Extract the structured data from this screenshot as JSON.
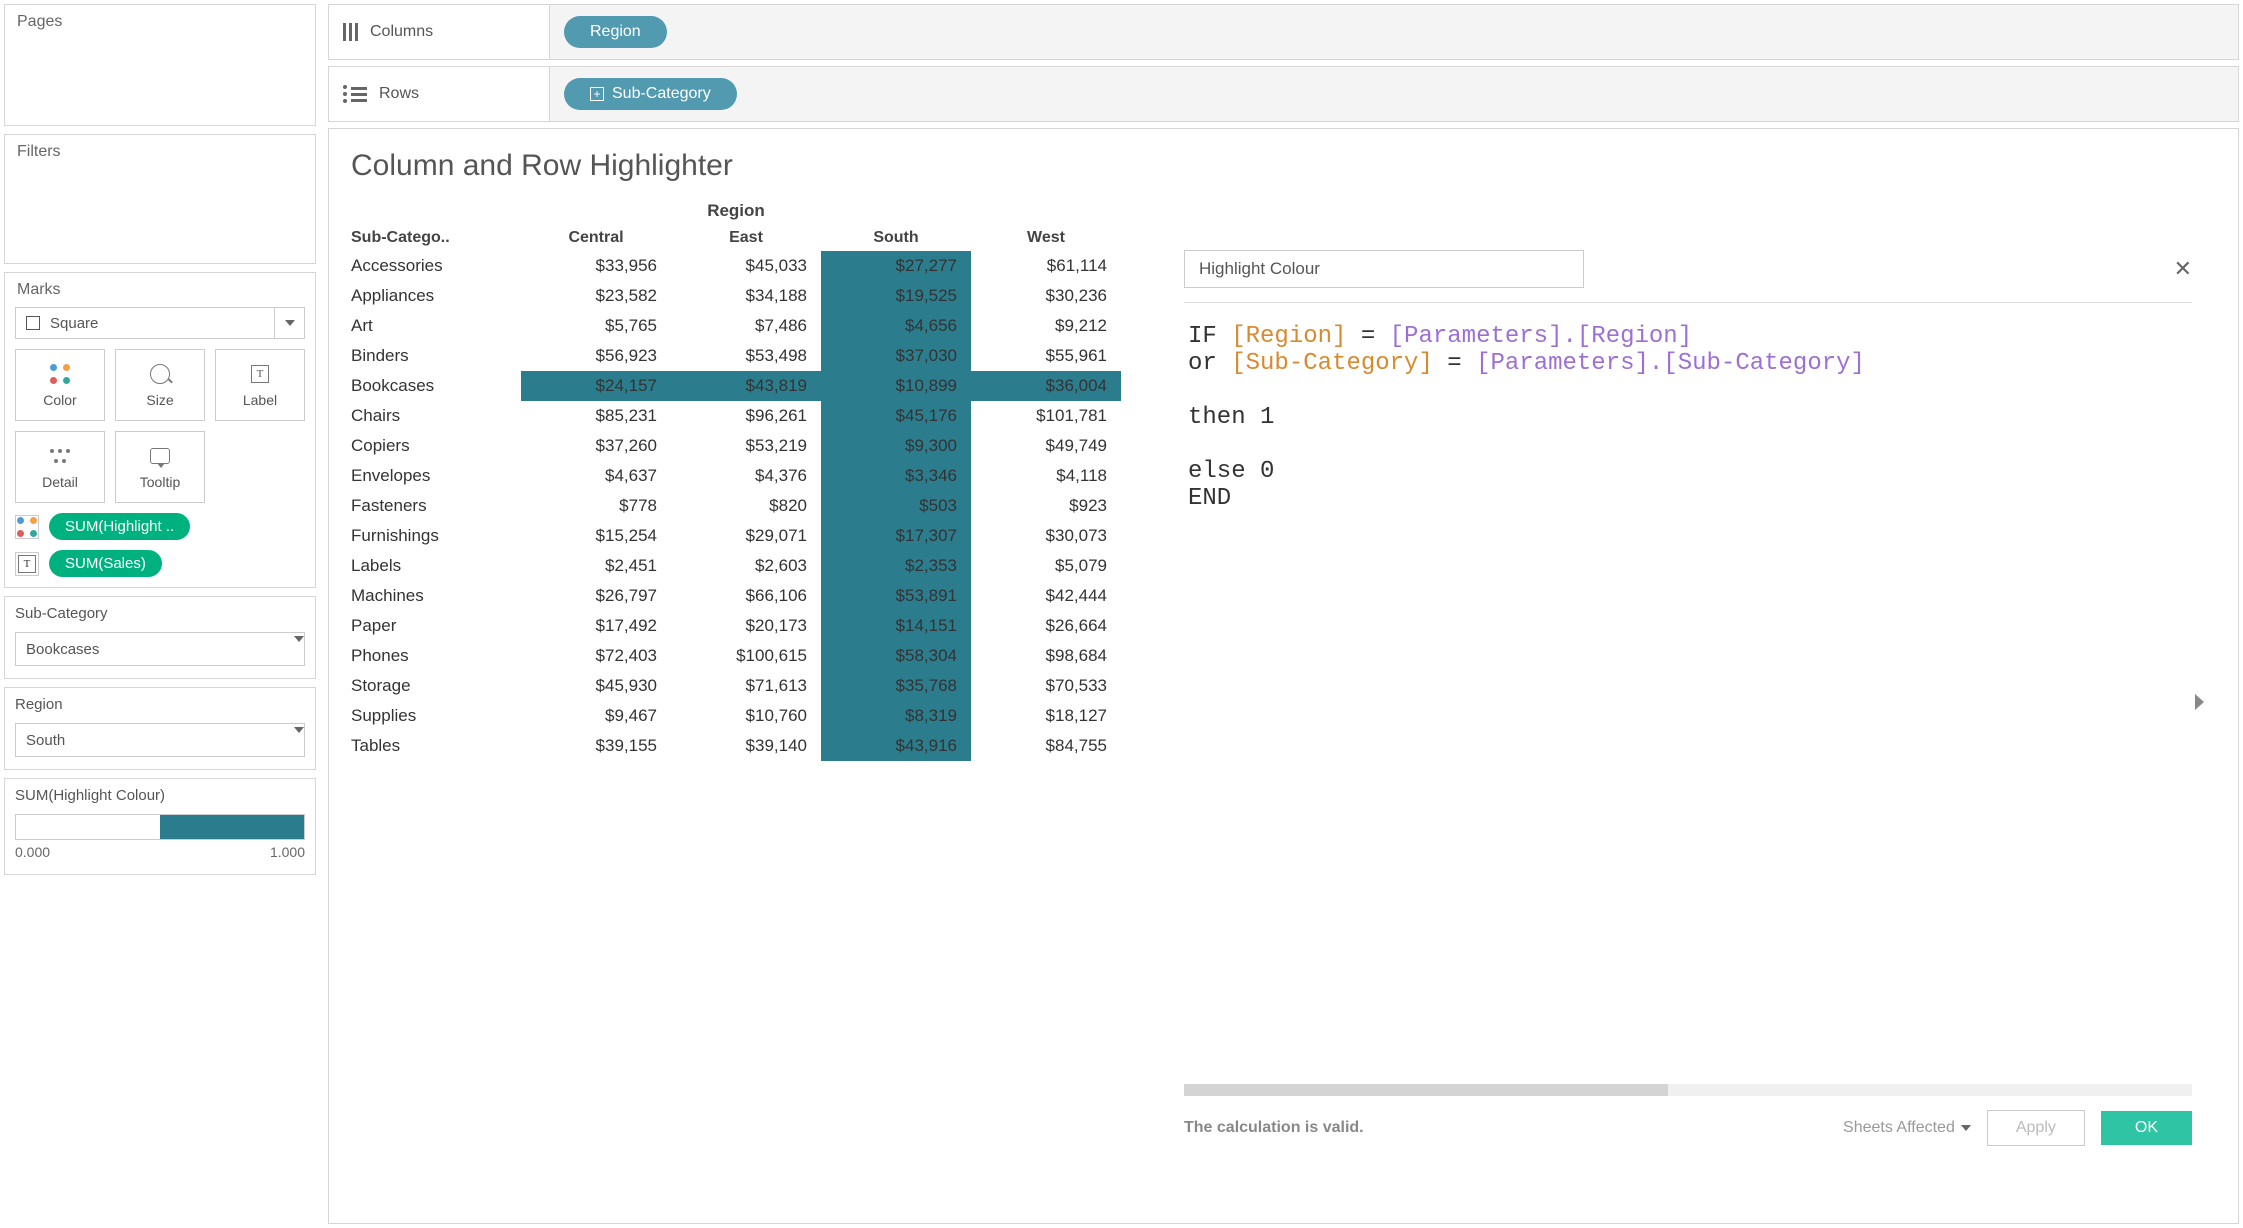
{
  "shelves": {
    "columns_label": "Columns",
    "rows_label": "Rows",
    "columns_pill": "Region",
    "rows_pill": "Sub-Category"
  },
  "left": {
    "pages_title": "Pages",
    "filters_title": "Filters",
    "marks_title": "Marks",
    "mark_type": "Square",
    "mark_buttons": {
      "color": "Color",
      "size": "Size",
      "label": "Label",
      "detail": "Detail",
      "tooltip": "Tooltip"
    },
    "mark_pills": {
      "pill1": "SUM(Highlight ..",
      "pill2": "SUM(Sales)"
    },
    "param_subcat": {
      "title": "Sub-Category",
      "value": "Bookcases"
    },
    "param_region": {
      "title": "Region",
      "value": "South"
    },
    "legend": {
      "title": "SUM(Highlight Colour)",
      "min": "0.000",
      "max": "1.000"
    }
  },
  "viz": {
    "title": "Column and Row Highlighter",
    "col_header": "Region",
    "row_header": "Sub-Catego..",
    "regions": [
      "Central",
      "East",
      "South",
      "West"
    ],
    "rows": [
      {
        "name": "Accessories",
        "vals": [
          "$33,956",
          "$45,033",
          "$27,277",
          "$61,114"
        ]
      },
      {
        "name": "Appliances",
        "vals": [
          "$23,582",
          "$34,188",
          "$19,525",
          "$30,236"
        ]
      },
      {
        "name": "Art",
        "vals": [
          "$5,765",
          "$7,486",
          "$4,656",
          "$9,212"
        ]
      },
      {
        "name": "Binders",
        "vals": [
          "$56,923",
          "$53,498",
          "$37,030",
          "$55,961"
        ]
      },
      {
        "name": "Bookcases",
        "vals": [
          "$24,157",
          "$43,819",
          "$10,899",
          "$36,004"
        ]
      },
      {
        "name": "Chairs",
        "vals": [
          "$85,231",
          "$96,261",
          "$45,176",
          "$101,781"
        ]
      },
      {
        "name": "Copiers",
        "vals": [
          "$37,260",
          "$53,219",
          "$9,300",
          "$49,749"
        ]
      },
      {
        "name": "Envelopes",
        "vals": [
          "$4,637",
          "$4,376",
          "$3,346",
          "$4,118"
        ]
      },
      {
        "name": "Fasteners",
        "vals": [
          "$778",
          "$820",
          "$503",
          "$923"
        ]
      },
      {
        "name": "Furnishings",
        "vals": [
          "$15,254",
          "$29,071",
          "$17,307",
          "$30,073"
        ]
      },
      {
        "name": "Labels",
        "vals": [
          "$2,451",
          "$2,603",
          "$2,353",
          "$5,079"
        ]
      },
      {
        "name": "Machines",
        "vals": [
          "$26,797",
          "$66,106",
          "$53,891",
          "$42,444"
        ]
      },
      {
        "name": "Paper",
        "vals": [
          "$17,492",
          "$20,173",
          "$14,151",
          "$26,664"
        ]
      },
      {
        "name": "Phones",
        "vals": [
          "$72,403",
          "$100,615",
          "$58,304",
          "$98,684"
        ]
      },
      {
        "name": "Storage",
        "vals": [
          "$45,930",
          "$71,613",
          "$35,768",
          "$70,533"
        ]
      },
      {
        "name": "Supplies",
        "vals": [
          "$9,467",
          "$10,760",
          "$8,319",
          "$18,127"
        ]
      },
      {
        "name": "Tables",
        "vals": [
          "$39,155",
          "$39,140",
          "$43,916",
          "$84,755"
        ]
      }
    ],
    "highlight_row": "Bookcases",
    "highlight_col_index": 2
  },
  "calc": {
    "name": "Highlight Colour",
    "tokens": {
      "if": "IF ",
      "region_field": "[Region]",
      "eq": " = ",
      "region_param": "[Parameters].[Region]",
      "or": "or ",
      "subcat_field": "[Sub-Category]",
      "subcat_param": "[Parameters].[Sub-Category]",
      "then": "then 1",
      "else": "else 0",
      "end": "END"
    },
    "valid_msg": "The calculation is valid.",
    "sheets_affected": "Sheets Affected",
    "apply": "Apply",
    "ok": "OK"
  }
}
